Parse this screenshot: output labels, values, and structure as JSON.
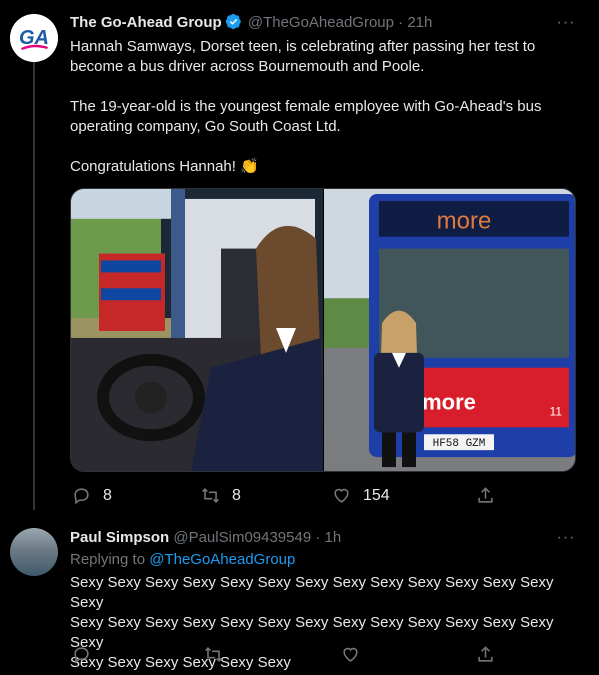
{
  "tweet1": {
    "display_name": "The Go-Ahead Group",
    "handle": "@TheGoAheadGroup",
    "time": "21h",
    "paragraphs": [
      "Hannah Samways, Dorset teen, is celebrating after passing her test to become a bus driver across Bournemouth and Poole.",
      "The 19-year-old is the youngest female employee with Go-Ahead's bus operating company, Go South Coast Ltd.",
      "Congratulations Hannah! 👏"
    ],
    "avatar_text": "GA",
    "bus_sign": "more",
    "bus_side_logo": "more",
    "plate": "HF58 GZM",
    "route_number": "11",
    "actions": {
      "replies": "8",
      "retweets": "8",
      "likes": "154"
    }
  },
  "tweet2": {
    "display_name": "Paul Simpson",
    "handle": "@PaulSim09439549",
    "time": "1h",
    "replying_prefix": "Replying to",
    "replying_to": "@TheGoAheadGroup",
    "text_lines": [
      "Sexy Sexy Sexy Sexy Sexy Sexy Sexy Sexy Sexy Sexy Sexy Sexy Sexy Sexy",
      "Sexy Sexy Sexy Sexy Sexy Sexy Sexy Sexy Sexy Sexy Sexy Sexy Sexy Sexy",
      "Sexy Sexy Sexy Sexy Sexy Sexy"
    ]
  },
  "icons": {
    "more": "more-icon",
    "reply": "reply-icon",
    "retweet": "retweet-icon",
    "like": "like-icon",
    "share": "share-icon",
    "verified": "verified-badge-icon"
  },
  "colors": {
    "background": "#000000",
    "text": "#e7e9ea",
    "muted": "#71767b",
    "link": "#1d9bf0",
    "verified": "#1d9bf0",
    "ga_blue": "#1a5aa8",
    "ga_pink": "#e6007e"
  }
}
